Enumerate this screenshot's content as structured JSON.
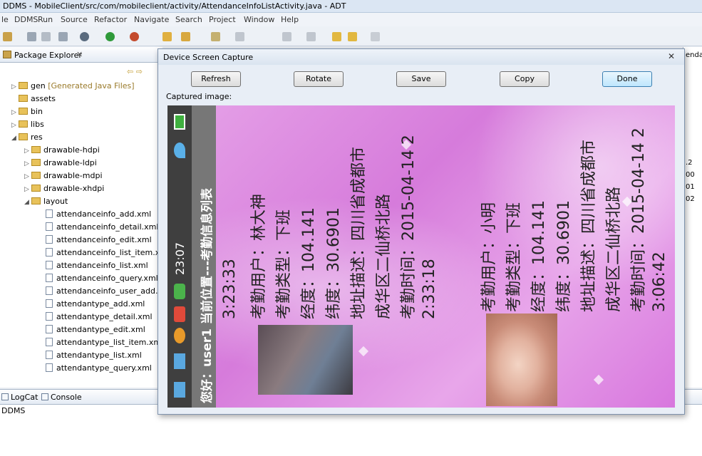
{
  "window": {
    "title": "DDMS - MobileClient/src/com/mobileclient/activity/AttendanceInfoListActivity.java - ADT"
  },
  "menu": [
    "le",
    "DDMS",
    "Run",
    "Source",
    "Refactor",
    "Navigate",
    "Search",
    "Project",
    "Window",
    "Help"
  ],
  "package_explorer": {
    "tab_label": "Package Explorer",
    "close": "✕",
    "tree": [
      {
        "label": "gen",
        "decoration": "[Generated Java Files]",
        "kind": "folder"
      },
      {
        "label": "assets",
        "kind": "folder"
      },
      {
        "label": "bin",
        "kind": "folder"
      },
      {
        "label": "libs",
        "kind": "folder"
      },
      {
        "label": "res",
        "kind": "folder"
      },
      {
        "label": "drawable-hdpi",
        "kind": "folder"
      },
      {
        "label": "drawable-ldpi",
        "kind": "folder"
      },
      {
        "label": "drawable-mdpi",
        "kind": "folder"
      },
      {
        "label": "drawable-xhdpi",
        "kind": "folder"
      },
      {
        "label": "layout",
        "kind": "folder"
      },
      {
        "label": "attendanceinfo_add.xml",
        "kind": "file"
      },
      {
        "label": "attendanceinfo_detail.xml",
        "kind": "file"
      },
      {
        "label": "attendanceinfo_edit.xml",
        "kind": "file"
      },
      {
        "label": "attendanceinfo_list_item.xml",
        "kind": "file"
      },
      {
        "label": "attendanceinfo_list.xml",
        "kind": "file"
      },
      {
        "label": "attendanceinfo_query.xml",
        "kind": "file"
      },
      {
        "label": "attendanceinfo_user_add.xn",
        "kind": "file"
      },
      {
        "label": "attendantype_add.xml",
        "kind": "file"
      },
      {
        "label": "attendantype_detail.xml",
        "kind": "file"
      },
      {
        "label": "attendantype_edit.xml",
        "kind": "file"
      },
      {
        "label": "attendantype_list_item.xml",
        "kind": "file"
      },
      {
        "label": "attendantype_list.xml",
        "kind": "file"
      },
      {
        "label": "attendantype_query.xml",
        "kind": "file"
      }
    ]
  },
  "right_panel": {
    "tab_fragment": "endanc",
    "values": [
      ".2",
      "00",
      "01",
      "02"
    ]
  },
  "bottom": {
    "tabs": [
      "LogCat",
      "Console"
    ],
    "perspective": "DDMS"
  },
  "dialog": {
    "title": "Device Screen Capture",
    "buttons": {
      "refresh": "Refresh",
      "rotate": "Rotate",
      "save": "Save",
      "copy": "Copy",
      "done": "Done"
    },
    "captured_label": "Captured image:"
  },
  "phone": {
    "time": "23:07",
    "header": "您好：user1  当前位置---考勤信息列表",
    "records": [
      {
        "lines": [
          "考勤用户：林大神",
          "考勤类型：下班",
          "经度：104.141",
          "纬度：30.6901",
          "地址描述：四川省成都市",
          "成华区二仙桥北路",
          "考勤时间：2015-04-14 2",
          "2:33:18"
        ],
        "tail_prev": "3:23:33"
      },
      {
        "lines": [
          "考勤用户：小明",
          "考勤类型：下班",
          "经度：104.141",
          "纬度：30.6901",
          "地址描述：四川省成都市",
          "成华区二仙桥北路",
          "考勤时间：2015-04-14 2",
          "3:06:42"
        ]
      }
    ]
  }
}
